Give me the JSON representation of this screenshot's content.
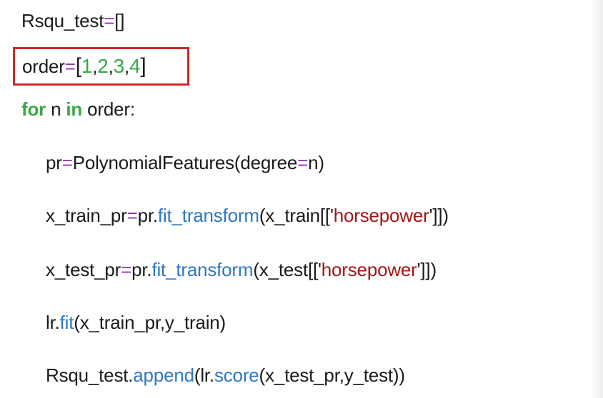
{
  "code": {
    "line1": {
      "var": "Rsqu_test",
      "op": "=",
      "rest": "[]"
    },
    "line2": {
      "var": "order",
      "op": "=",
      "open": "[",
      "close": "]",
      "n1": "1",
      "n2": "2",
      "n3": "3",
      "n4": "4",
      "comma": ","
    },
    "line3": {
      "kw_for": "for",
      "var": " n ",
      "kw_in": "in",
      "rest": " order:"
    },
    "line4": {
      "a": "pr",
      "op1": "=",
      "b": "PolynomialFeatures(degree",
      "op2": "=",
      "c": "n)"
    },
    "line5": {
      "a": "x_train_pr",
      "op": "=",
      "b": "pr.",
      "fn": "fit_transform",
      "c": "(x_train[['",
      "str": "horsepower",
      "d": "']])"
    },
    "line6": {
      "a": "x_test_pr",
      "op": "=",
      "b": "pr.",
      "fn": "fit_transform",
      "c": "(x_test[['",
      "str": "horsepower",
      "d": "']])"
    },
    "line7": {
      "a": "lr.",
      "fn": "fit",
      "b": "(x_train_pr,y_train)"
    },
    "line8": {
      "a": "Rsqu_test.",
      "fn1": "append",
      "b": "(lr.",
      "fn2": "score",
      "c": "(x_test_pr,y_test))"
    }
  },
  "colors": {
    "operator": "#8e3aa8",
    "number": "#3aa845",
    "keyword": "#3aa845",
    "function": "#2e78c2",
    "string": "#a31515",
    "highlight_border": "#cc2a2a"
  }
}
